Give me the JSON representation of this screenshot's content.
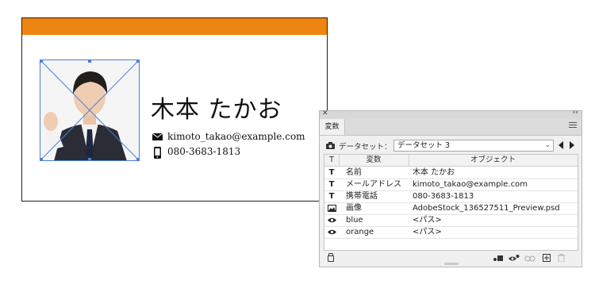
{
  "card": {
    "name": "木本 たかお",
    "email": "kimoto_takao@example.com",
    "phone": "080-3683-1813",
    "band_color": "#ee8510"
  },
  "panel": {
    "tab_label": "変数",
    "dataset_label": "データセット：",
    "dataset_value": "データセット 3",
    "columns": {
      "type": "T",
      "variable": "変数",
      "object": "オブジェクト"
    },
    "rows": [
      {
        "icon": "text-icon",
        "glyph": "T",
        "variable": "名前",
        "object": "木本 たかお"
      },
      {
        "icon": "text-icon",
        "glyph": "T",
        "variable": "メールアドレス",
        "object": "kimoto_takao@example.com"
      },
      {
        "icon": "text-icon",
        "glyph": "T",
        "variable": "携帯電話",
        "object": "080-3683-1813"
      },
      {
        "icon": "image-icon",
        "glyph": "",
        "variable": "画像",
        "object": "AdobeStock_136527511_Preview.psd"
      },
      {
        "icon": "visibility-icon",
        "glyph": "",
        "variable": "blue",
        "object": "<パス>"
      },
      {
        "icon": "visibility-icon",
        "glyph": "",
        "variable": "orange",
        "object": "<パス>"
      }
    ]
  }
}
